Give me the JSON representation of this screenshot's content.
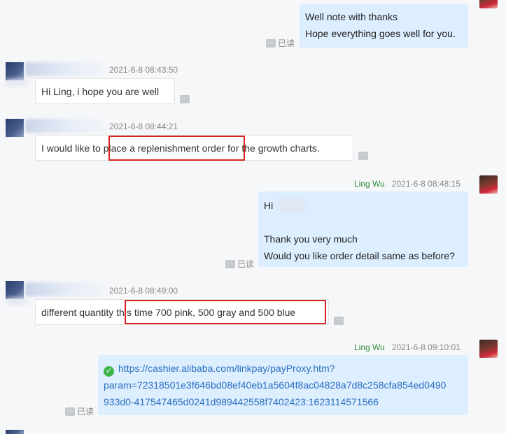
{
  "messages": [
    {
      "direction": "out",
      "lines": [
        "Well note with thanks",
        "Hope everything goes well for you."
      ],
      "read": "已读"
    },
    {
      "direction": "in",
      "timestamp": "2021-6-8 08:43:50",
      "text": "Hi Ling, i hope you are well"
    },
    {
      "direction": "in",
      "timestamp": "2021-6-8 08:44:21",
      "text_before": "I would like to ",
      "text_highlight": "place a replenishment order",
      "text_after": " for the growth charts."
    },
    {
      "direction": "out",
      "sender": "Ling Wu",
      "timestamp": "2021-6-8 08:48:15",
      "line1": "Hi",
      "line2": "Thank you very much",
      "line3": "Would you like order detail same as before?",
      "read": "已读"
    },
    {
      "direction": "in",
      "timestamp": "2021-6-8 08:49:00",
      "text_before": "different quantity ",
      "text_highlight": "this time 700 pink, 500 gray and 500 blue"
    },
    {
      "direction": "out",
      "sender": "Ling Wu",
      "timestamp": "2021-6-8 09:10:01",
      "link_lines": [
        "https://cashier.alibaba.com/linkpay/payProxy.htm?",
        "param=72318501e3f646bd08ef40eb1a5604f8ac04828a7d8c258cfa854ed0490",
        "933d0-417547465d0241d989442558f7402423:1623114571566"
      ],
      "link_status_icon": "check-circle-icon",
      "read": "已读"
    }
  ],
  "colors": {
    "outgoing_bubble": "#ddeeff",
    "incoming_bubble": "#ffffff",
    "sender_name": "#2e8b3a",
    "link": "#2a6fc0",
    "highlight_box": "#d9231d",
    "background": "#f6f7f9"
  },
  "icons": {
    "more": "more-options-icon",
    "avatar_self": "avatar",
    "avatar_other": "avatar"
  }
}
